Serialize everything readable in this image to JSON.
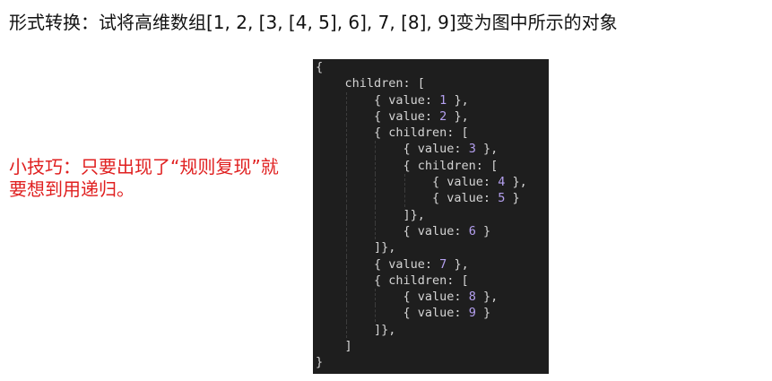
{
  "question": {
    "text": "形式转换：试将高维数组[1, 2, [3, [4, 5], 6], 7, [8], 9]变为图中所示的对象"
  },
  "tip": {
    "text": "小技巧：只要出现了“规则复现”就要想到用递归。"
  },
  "code": {
    "colors": {
      "background": "#1e1e1e",
      "text": "#d4d4d4",
      "number": "#b5a0f0",
      "tip": "#e02020",
      "guide": "#3c3c3c"
    },
    "lines": [
      [
        {
          "t": "{"
        }
      ],
      [
        {
          "t": "    children: ["
        }
      ],
      [
        {
          "t": "        { value: "
        },
        {
          "t": "1",
          "n": true
        },
        {
          "t": " },"
        }
      ],
      [
        {
          "t": "        { value: "
        },
        {
          "t": "2",
          "n": true
        },
        {
          "t": " },"
        }
      ],
      [
        {
          "t": "        { children: ["
        }
      ],
      [
        {
          "t": "            { value: "
        },
        {
          "t": "3",
          "n": true
        },
        {
          "t": " },"
        }
      ],
      [
        {
          "t": "            { children: ["
        }
      ],
      [
        {
          "t": "                { value: "
        },
        {
          "t": "4",
          "n": true
        },
        {
          "t": " },"
        }
      ],
      [
        {
          "t": "                { value: "
        },
        {
          "t": "5",
          "n": true
        },
        {
          "t": " }"
        }
      ],
      [
        {
          "t": "            ]},"
        }
      ],
      [
        {
          "t": "            { value: "
        },
        {
          "t": "6",
          "n": true
        },
        {
          "t": " }"
        }
      ],
      [
        {
          "t": "        ]},"
        }
      ],
      [
        {
          "t": "        { value: "
        },
        {
          "t": "7",
          "n": true
        },
        {
          "t": " },"
        }
      ],
      [
        {
          "t": "        { children: ["
        }
      ],
      [
        {
          "t": "            { value: "
        },
        {
          "t": "8",
          "n": true
        },
        {
          "t": " },"
        }
      ],
      [
        {
          "t": "            { value: "
        },
        {
          "t": "9",
          "n": true
        },
        {
          "t": " }"
        }
      ],
      [
        {
          "t": "        ]},"
        }
      ],
      [
        {
          "t": "    ]"
        }
      ],
      [
        {
          "t": "}"
        }
      ]
    ]
  }
}
